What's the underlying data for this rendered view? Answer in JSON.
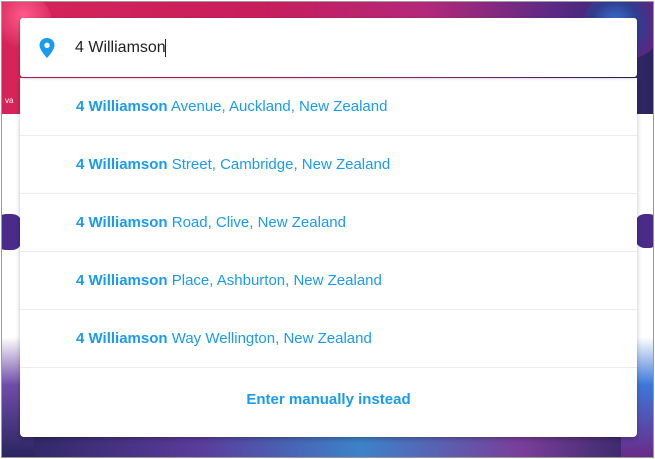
{
  "colors": {
    "accent": "#1a9bef",
    "text": "#222222",
    "background_brand": "#d6245a"
  },
  "search": {
    "icon": "map-pin-icon",
    "value": "4 Williamson"
  },
  "suggestions": [
    {
      "match": "4 Williamson",
      "rest": " Avenue, Auckland, New Zealand"
    },
    {
      "match": "4 Williamson",
      "rest": " Street, Cambridge, New Zealand"
    },
    {
      "match": "4 Williamson",
      "rest": " Road, Clive, New Zealand"
    },
    {
      "match": "4 Williamson",
      "rest": " Place, Ashburton, New Zealand"
    },
    {
      "match": "4 Williamson",
      "rest": " Way Wellington, New Zealand"
    }
  ],
  "manual_entry_label": "Enter manually instead",
  "background_fragment": "va"
}
